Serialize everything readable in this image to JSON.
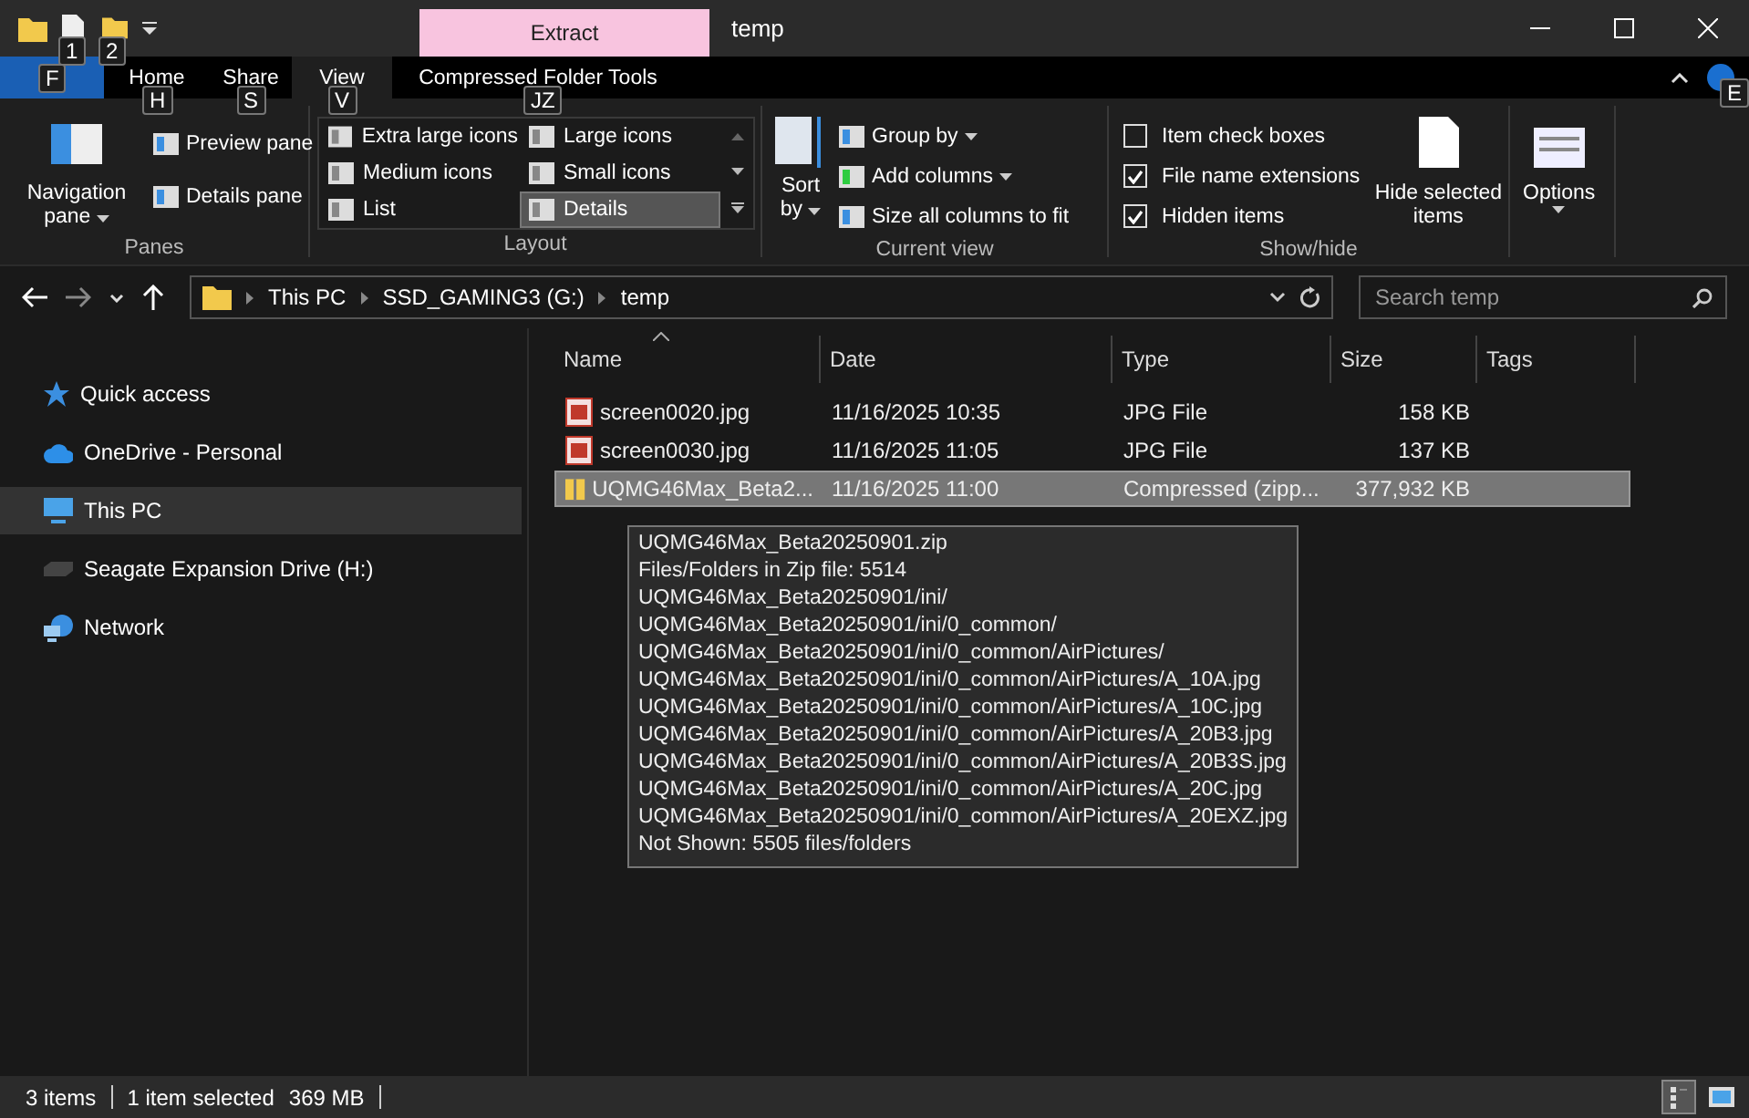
{
  "title_bar": {
    "quick_access": [
      {
        "kind": "properties",
        "key_tip": "1"
      },
      {
        "kind": "folder",
        "key_tip": "2"
      }
    ],
    "context_tab": "Extract",
    "title": "temp"
  },
  "ribbon_tabs": [
    {
      "kind": "file",
      "key_tip": "F",
      "selected": false
    },
    {
      "kind": "tab",
      "label": "Home",
      "key_tip": "H",
      "selected": false
    },
    {
      "kind": "tab",
      "label": "Share",
      "key_tip": "S",
      "selected": false
    },
    {
      "kind": "tab",
      "label": "View",
      "key_tip": "V",
      "selected": true
    },
    {
      "kind": "context",
      "label": "Compressed Folder Tools",
      "key_tip": "JZ",
      "selected": false
    }
  ],
  "help_key_tip": "E",
  "ribbon": {
    "panes": {
      "label": "Panes",
      "navigation_pane": "Navigation pane",
      "items": [
        "Preview pane",
        "Details pane"
      ]
    },
    "layout": {
      "label": "Layout",
      "options": [
        {
          "label": "Extra large icons",
          "selected": false
        },
        {
          "label": "Large icons",
          "selected": false
        },
        {
          "label": "Medium icons",
          "selected": false
        },
        {
          "label": "Small icons",
          "selected": false
        },
        {
          "label": "List",
          "selected": false
        },
        {
          "label": "Details",
          "selected": true
        }
      ]
    },
    "current_view": {
      "label": "Current view",
      "sort_by": "Sort by",
      "items": [
        "Group by",
        "Add columns",
        "Size all columns to fit"
      ]
    },
    "show_hide": {
      "label": "Show/hide",
      "checkboxes": [
        {
          "label": "Item check boxes",
          "checked": false
        },
        {
          "label": "File name extensions",
          "checked": true
        },
        {
          "label": "Hidden items",
          "checked": true
        }
      ],
      "hide_selected": "Hide selected items"
    },
    "options": "Options"
  },
  "address": {
    "breadcrumb": [
      "This PC",
      "SSD_GAMING3 (G:)",
      "temp"
    ],
    "search_placeholder": "Search temp"
  },
  "navigation": [
    {
      "kind": "star",
      "label": "Quick access",
      "selected": false
    },
    {
      "kind": "cloud",
      "label": "OneDrive - Personal",
      "selected": false
    },
    {
      "kind": "pc",
      "label": "This PC",
      "selected": true
    },
    {
      "kind": "drive",
      "label": "Seagate Expansion Drive (H:)",
      "selected": false
    },
    {
      "kind": "network",
      "label": "Network",
      "selected": false
    }
  ],
  "table": {
    "columns": [
      "Name",
      "Date",
      "Type",
      "Size",
      "Tags"
    ],
    "rows": [
      {
        "kind": "image",
        "name": "screen0020.jpg",
        "date": "11/16/2025 10:35",
        "type": "JPG File",
        "size": "158 KB",
        "selected": false
      },
      {
        "kind": "image",
        "name": "screen0030.jpg",
        "date": "11/16/2025 11:05",
        "type": "JPG File",
        "size": "137 KB",
        "selected": false
      },
      {
        "kind": "zip",
        "name": "UQMG46Max_Beta2...",
        "date": "11/16/2025 11:00",
        "type": "Compressed (zipp...",
        "size": "377,932 KB",
        "selected": true
      }
    ]
  },
  "tooltip": [
    "UQMG46Max_Beta20250901.zip",
    "Files/Folders in Zip file: 5514",
    "UQMG46Max_Beta20250901/ini/",
    "UQMG46Max_Beta20250901/ini/0_common/",
    "UQMG46Max_Beta20250901/ini/0_common/AirPictures/",
    "UQMG46Max_Beta20250901/ini/0_common/AirPictures/A_10A.jpg",
    "UQMG46Max_Beta20250901/ini/0_common/AirPictures/A_10C.jpg",
    "UQMG46Max_Beta20250901/ini/0_common/AirPictures/A_20B3.jpg",
    "UQMG46Max_Beta20250901/ini/0_common/AirPictures/A_20B3S.jpg",
    "UQMG46Max_Beta20250901/ini/0_common/AirPictures/A_20C.jpg",
    "UQMG46Max_Beta20250901/ini/0_common/AirPictures/A_20EXZ.jpg",
    "Not Shown: 5505 files/folders"
  ],
  "status_bar": {
    "items": [
      "3 items",
      "1 item selected",
      "369 MB"
    ],
    "views": [
      {
        "kind": "details",
        "selected": true
      },
      {
        "kind": "large",
        "selected": false
      }
    ]
  }
}
